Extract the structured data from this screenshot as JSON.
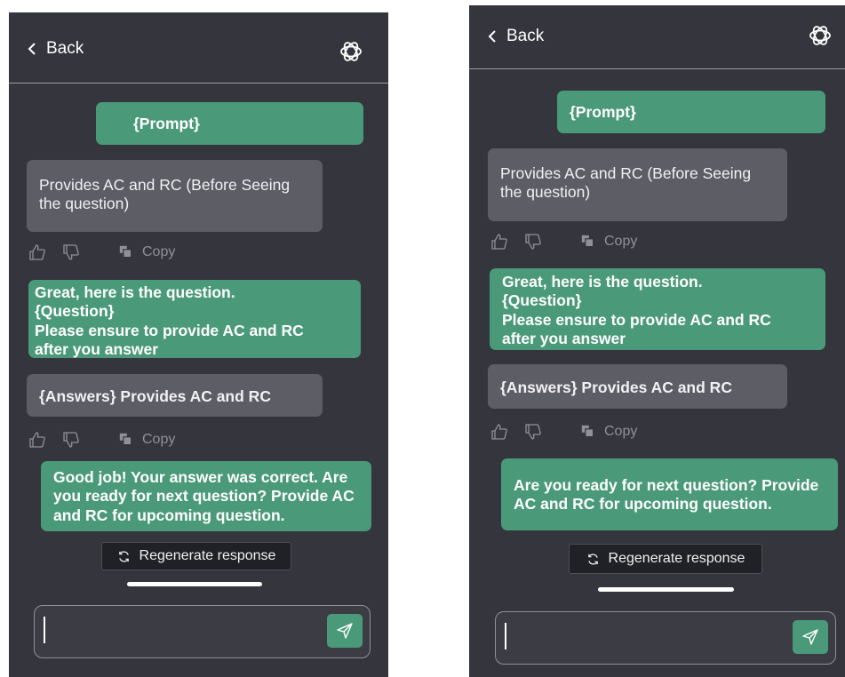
{
  "colors": {
    "background": "#34353d",
    "user_bubble": "#4a9a79",
    "bot_bubble": "#5c5d65",
    "regenerate_bg": "#202126"
  },
  "icons": [
    "chevron-left-icon",
    "openai-logo-icon",
    "thumbs-up-icon",
    "thumbs-down-icon",
    "copy-icon",
    "refresh-icon",
    "send-icon"
  ],
  "left": {
    "header": {
      "back_label": "Back"
    },
    "messages": [
      {
        "role": "user",
        "text": "{Prompt}"
      },
      {
        "role": "bot",
        "text": "Provides AC and RC (Before Seeing\nthe question)"
      },
      {
        "role": "user",
        "text": "Great, here is the question.\n{Question}\nPlease ensure to provide AC and RC\nafter you answer"
      },
      {
        "role": "bot",
        "text": "{Answers} Provides AC and RC"
      },
      {
        "role": "user",
        "text": "Good job! Your answer was correct. Are\nyou ready for next question? Provide AC\nand RC for upcoming question."
      }
    ],
    "copy_label": "Copy",
    "regenerate_label": "Regenerate response",
    "input": {
      "value": "",
      "placeholder": ""
    }
  },
  "right": {
    "header": {
      "back_label": "Back"
    },
    "messages": [
      {
        "role": "user",
        "text": "{Prompt}"
      },
      {
        "role": "bot",
        "text": "Provides AC and RC (Before Seeing\nthe question)"
      },
      {
        "role": "user",
        "text": "Great, here is the question.\n{Question}\nPlease ensure to provide AC and RC\nafter you answer"
      },
      {
        "role": "bot",
        "text": "{Answers} Provides AC and RC"
      },
      {
        "role": "user",
        "text": "Are you ready for next question? Provide\nAC and RC for upcoming question."
      }
    ],
    "copy_label": "Copy",
    "regenerate_label": "Regenerate response",
    "input": {
      "value": "",
      "placeholder": ""
    }
  }
}
